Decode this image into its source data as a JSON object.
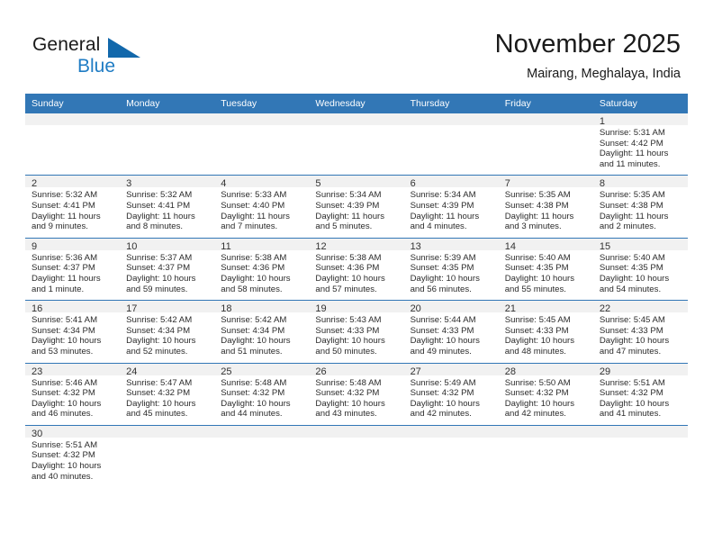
{
  "brand": {
    "name_part1": "General",
    "name_part2": "Blue",
    "flag_color": "#1f7cc4",
    "text_color": "#1a1a1a"
  },
  "header": {
    "title": "November 2025",
    "subtitle": "Mairang, Meghalaya, India"
  },
  "theme": {
    "header_blue": "#3277b6",
    "daynum_background": "#f1f1f1",
    "grid_line": "#3277b6"
  },
  "weekdays": [
    "Sunday",
    "Monday",
    "Tuesday",
    "Wednesday",
    "Thursday",
    "Friday",
    "Saturday"
  ],
  "labels": {
    "sunrise": "Sunrise:",
    "sunset": "Sunset:",
    "daylight": "Daylight:"
  },
  "weeks": [
    [
      {
        "day": "",
        "sunrise": "",
        "sunset": "",
        "daylight": ""
      },
      {
        "day": "",
        "sunrise": "",
        "sunset": "",
        "daylight": ""
      },
      {
        "day": "",
        "sunrise": "",
        "sunset": "",
        "daylight": ""
      },
      {
        "day": "",
        "sunrise": "",
        "sunset": "",
        "daylight": ""
      },
      {
        "day": "",
        "sunrise": "",
        "sunset": "",
        "daylight": ""
      },
      {
        "day": "",
        "sunrise": "",
        "sunset": "",
        "daylight": ""
      },
      {
        "day": "1",
        "sunrise": "Sunrise: 5:31 AM",
        "sunset": "Sunset: 4:42 PM",
        "daylight": "Daylight: 11 hours and 11 minutes."
      }
    ],
    [
      {
        "day": "2",
        "sunrise": "Sunrise: 5:32 AM",
        "sunset": "Sunset: 4:41 PM",
        "daylight": "Daylight: 11 hours and 9 minutes."
      },
      {
        "day": "3",
        "sunrise": "Sunrise: 5:32 AM",
        "sunset": "Sunset: 4:41 PM",
        "daylight": "Daylight: 11 hours and 8 minutes."
      },
      {
        "day": "4",
        "sunrise": "Sunrise: 5:33 AM",
        "sunset": "Sunset: 4:40 PM",
        "daylight": "Daylight: 11 hours and 7 minutes."
      },
      {
        "day": "5",
        "sunrise": "Sunrise: 5:34 AM",
        "sunset": "Sunset: 4:39 PM",
        "daylight": "Daylight: 11 hours and 5 minutes."
      },
      {
        "day": "6",
        "sunrise": "Sunrise: 5:34 AM",
        "sunset": "Sunset: 4:39 PM",
        "daylight": "Daylight: 11 hours and 4 minutes."
      },
      {
        "day": "7",
        "sunrise": "Sunrise: 5:35 AM",
        "sunset": "Sunset: 4:38 PM",
        "daylight": "Daylight: 11 hours and 3 minutes."
      },
      {
        "day": "8",
        "sunrise": "Sunrise: 5:35 AM",
        "sunset": "Sunset: 4:38 PM",
        "daylight": "Daylight: 11 hours and 2 minutes."
      }
    ],
    [
      {
        "day": "9",
        "sunrise": "Sunrise: 5:36 AM",
        "sunset": "Sunset: 4:37 PM",
        "daylight": "Daylight: 11 hours and 1 minute."
      },
      {
        "day": "10",
        "sunrise": "Sunrise: 5:37 AM",
        "sunset": "Sunset: 4:37 PM",
        "daylight": "Daylight: 10 hours and 59 minutes."
      },
      {
        "day": "11",
        "sunrise": "Sunrise: 5:38 AM",
        "sunset": "Sunset: 4:36 PM",
        "daylight": "Daylight: 10 hours and 58 minutes."
      },
      {
        "day": "12",
        "sunrise": "Sunrise: 5:38 AM",
        "sunset": "Sunset: 4:36 PM",
        "daylight": "Daylight: 10 hours and 57 minutes."
      },
      {
        "day": "13",
        "sunrise": "Sunrise: 5:39 AM",
        "sunset": "Sunset: 4:35 PM",
        "daylight": "Daylight: 10 hours and 56 minutes."
      },
      {
        "day": "14",
        "sunrise": "Sunrise: 5:40 AM",
        "sunset": "Sunset: 4:35 PM",
        "daylight": "Daylight: 10 hours and 55 minutes."
      },
      {
        "day": "15",
        "sunrise": "Sunrise: 5:40 AM",
        "sunset": "Sunset: 4:35 PM",
        "daylight": "Daylight: 10 hours and 54 minutes."
      }
    ],
    [
      {
        "day": "16",
        "sunrise": "Sunrise: 5:41 AM",
        "sunset": "Sunset: 4:34 PM",
        "daylight": "Daylight: 10 hours and 53 minutes."
      },
      {
        "day": "17",
        "sunrise": "Sunrise: 5:42 AM",
        "sunset": "Sunset: 4:34 PM",
        "daylight": "Daylight: 10 hours and 52 minutes."
      },
      {
        "day": "18",
        "sunrise": "Sunrise: 5:42 AM",
        "sunset": "Sunset: 4:34 PM",
        "daylight": "Daylight: 10 hours and 51 minutes."
      },
      {
        "day": "19",
        "sunrise": "Sunrise: 5:43 AM",
        "sunset": "Sunset: 4:33 PM",
        "daylight": "Daylight: 10 hours and 50 minutes."
      },
      {
        "day": "20",
        "sunrise": "Sunrise: 5:44 AM",
        "sunset": "Sunset: 4:33 PM",
        "daylight": "Daylight: 10 hours and 49 minutes."
      },
      {
        "day": "21",
        "sunrise": "Sunrise: 5:45 AM",
        "sunset": "Sunset: 4:33 PM",
        "daylight": "Daylight: 10 hours and 48 minutes."
      },
      {
        "day": "22",
        "sunrise": "Sunrise: 5:45 AM",
        "sunset": "Sunset: 4:33 PM",
        "daylight": "Daylight: 10 hours and 47 minutes."
      }
    ],
    [
      {
        "day": "23",
        "sunrise": "Sunrise: 5:46 AM",
        "sunset": "Sunset: 4:32 PM",
        "daylight": "Daylight: 10 hours and 46 minutes."
      },
      {
        "day": "24",
        "sunrise": "Sunrise: 5:47 AM",
        "sunset": "Sunset: 4:32 PM",
        "daylight": "Daylight: 10 hours and 45 minutes."
      },
      {
        "day": "25",
        "sunrise": "Sunrise: 5:48 AM",
        "sunset": "Sunset: 4:32 PM",
        "daylight": "Daylight: 10 hours and 44 minutes."
      },
      {
        "day": "26",
        "sunrise": "Sunrise: 5:48 AM",
        "sunset": "Sunset: 4:32 PM",
        "daylight": "Daylight: 10 hours and 43 minutes."
      },
      {
        "day": "27",
        "sunrise": "Sunrise: 5:49 AM",
        "sunset": "Sunset: 4:32 PM",
        "daylight": "Daylight: 10 hours and 42 minutes."
      },
      {
        "day": "28",
        "sunrise": "Sunrise: 5:50 AM",
        "sunset": "Sunset: 4:32 PM",
        "daylight": "Daylight: 10 hours and 42 minutes."
      },
      {
        "day": "29",
        "sunrise": "Sunrise: 5:51 AM",
        "sunset": "Sunset: 4:32 PM",
        "daylight": "Daylight: 10 hours and 41 minutes."
      }
    ],
    [
      {
        "day": "30",
        "sunrise": "Sunrise: 5:51 AM",
        "sunset": "Sunset: 4:32 PM",
        "daylight": "Daylight: 10 hours and 40 minutes."
      },
      {
        "day": "",
        "sunrise": "",
        "sunset": "",
        "daylight": ""
      },
      {
        "day": "",
        "sunrise": "",
        "sunset": "",
        "daylight": ""
      },
      {
        "day": "",
        "sunrise": "",
        "sunset": "",
        "daylight": ""
      },
      {
        "day": "",
        "sunrise": "",
        "sunset": "",
        "daylight": ""
      },
      {
        "day": "",
        "sunrise": "",
        "sunset": "",
        "daylight": ""
      },
      {
        "day": "",
        "sunrise": "",
        "sunset": "",
        "daylight": ""
      }
    ]
  ]
}
